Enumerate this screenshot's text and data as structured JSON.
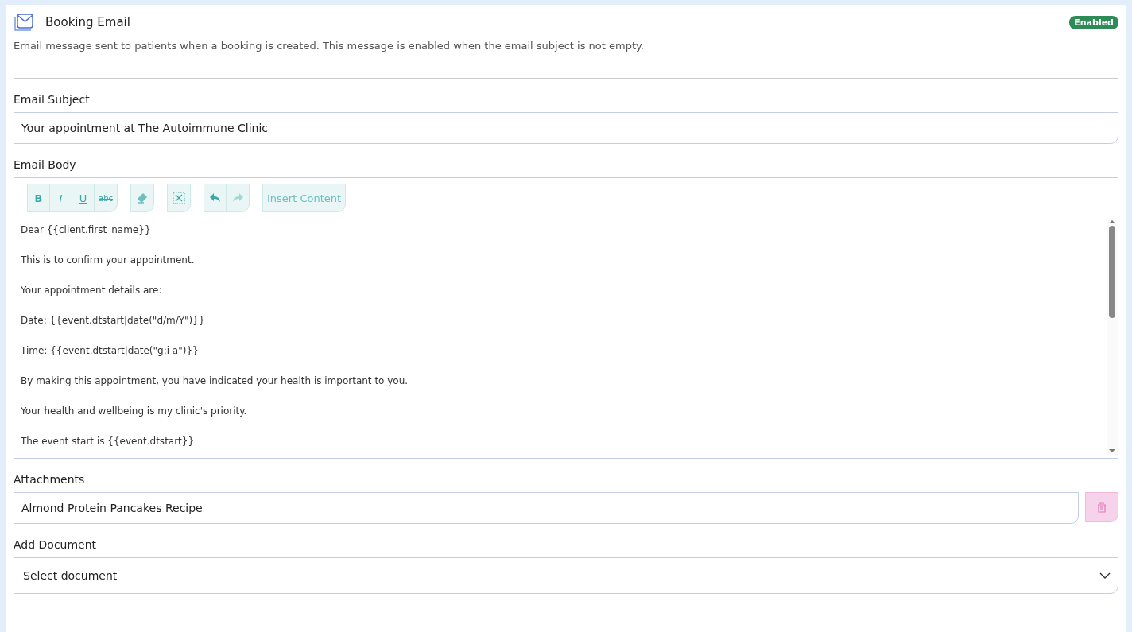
{
  "header": {
    "title": "Booking Email",
    "badge": "Enabled",
    "enabled": true,
    "description": "Email message sent to patients when a booking is created. This message is enabled when the email subject is not empty."
  },
  "subject": {
    "label": "Email Subject",
    "value": "Your appointment at The Autoimmune Clinic"
  },
  "body": {
    "label": "Email Body",
    "toolbar": [
      {
        "items": [
          {
            "kind": "bold",
            "text": "B",
            "disabled": false
          },
          {
            "kind": "italic",
            "text": "I",
            "disabled": false
          },
          {
            "kind": "underline",
            "text": "U",
            "disabled": false
          },
          {
            "kind": "strike",
            "text": "abc",
            "disabled": false
          }
        ]
      },
      {
        "items": [
          {
            "kind": "eraser",
            "disabled": false
          }
        ]
      },
      {
        "items": [
          {
            "kind": "fullscreen",
            "disabled": false
          }
        ]
      },
      {
        "items": [
          {
            "kind": "undo",
            "disabled": false
          },
          {
            "kind": "redo",
            "disabled": true
          }
        ]
      },
      {
        "items": [
          {
            "kind": "insert",
            "text": "Insert Content",
            "disabled": false
          }
        ]
      }
    ],
    "paragraphs": [
      "Dear {{client.first_name}}",
      "This is to confirm your appointment.",
      "Your appointment details are:",
      "Date: {{event.dtstart|date(\"d/m/Y\")}}",
      "Time: {{event.dtstart|date(\"g:i a\")}}",
      "By making this appointment, you have indicated your health is important to you.",
      "Your health and wellbeing is my clinic's priority.",
      "The event start is {{event.dtstart}}"
    ]
  },
  "attachments": {
    "label": "Attachments",
    "items": [
      {
        "name": "Almond Protein Pancakes Recipe"
      }
    ]
  },
  "add_document": {
    "label": "Add Document",
    "placeholder": "Select document"
  }
}
